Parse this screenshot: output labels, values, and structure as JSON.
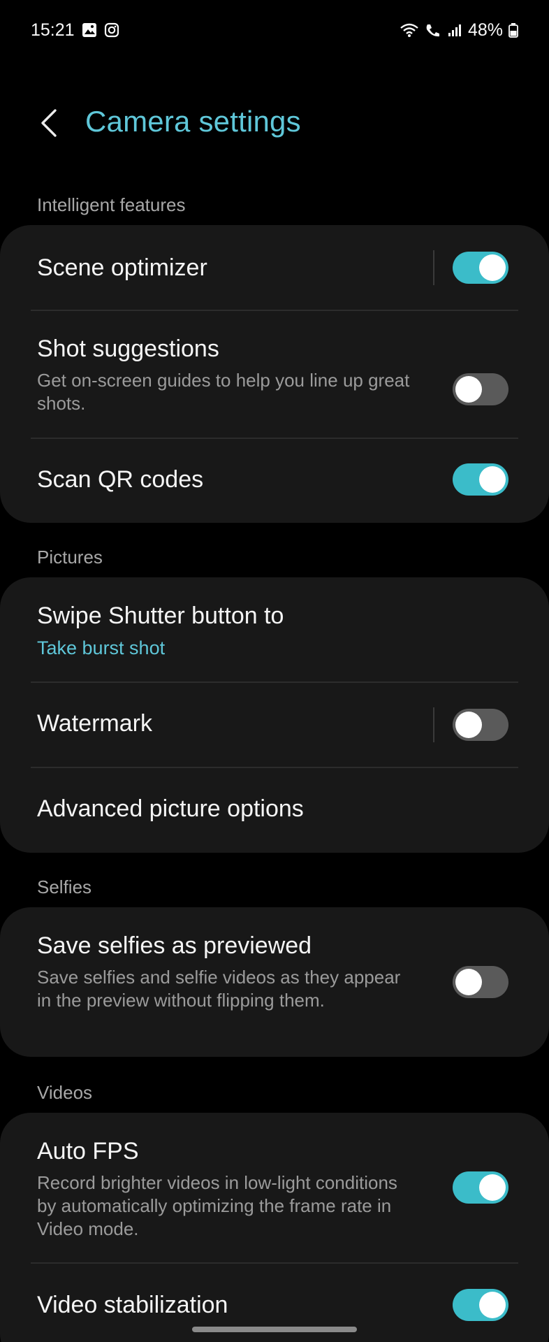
{
  "status_bar": {
    "time": "15:21",
    "battery": "48%",
    "icons_left": [
      "gallery-icon",
      "instagram-icon"
    ],
    "icons_right": [
      "wifi-icon",
      "call-icon",
      "signal-icon",
      "battery-icon"
    ]
  },
  "header": {
    "back_icon": "chevron-left-icon",
    "title": "Camera settings"
  },
  "colors": {
    "accent": "#5fc7d9",
    "toggle_on": "#3bbcc9",
    "toggle_off": "#5a5a5a",
    "card_bg": "#181818"
  },
  "sections": {
    "intelligent": {
      "label": "Intelligent features",
      "scene_optimizer": {
        "title": "Scene optimizer",
        "enabled": true
      },
      "shot_suggestions": {
        "title": "Shot suggestions",
        "subtitle": "Get on-screen guides to help you line up great shots.",
        "enabled": false
      },
      "scan_qr": {
        "title": "Scan QR codes",
        "enabled": true
      }
    },
    "pictures": {
      "label": "Pictures",
      "swipe_shutter": {
        "title": "Swipe Shutter button to",
        "value": "Take burst shot"
      },
      "watermark": {
        "title": "Watermark",
        "enabled": false
      },
      "advanced": {
        "title": "Advanced picture options"
      }
    },
    "selfies": {
      "label": "Selfies",
      "save_selfies": {
        "title": "Save selfies as previewed",
        "subtitle": "Save selfies and selfie videos as they appear in the preview without flipping them.",
        "enabled": false
      }
    },
    "videos": {
      "label": "Videos",
      "auto_fps": {
        "title": "Auto FPS",
        "subtitle": "Record brighter videos in low-light conditions by automatically optimizing the frame rate in Video mode.",
        "enabled": true
      },
      "video_stabilization": {
        "title": "Video stabilization",
        "enabled": true
      }
    }
  }
}
